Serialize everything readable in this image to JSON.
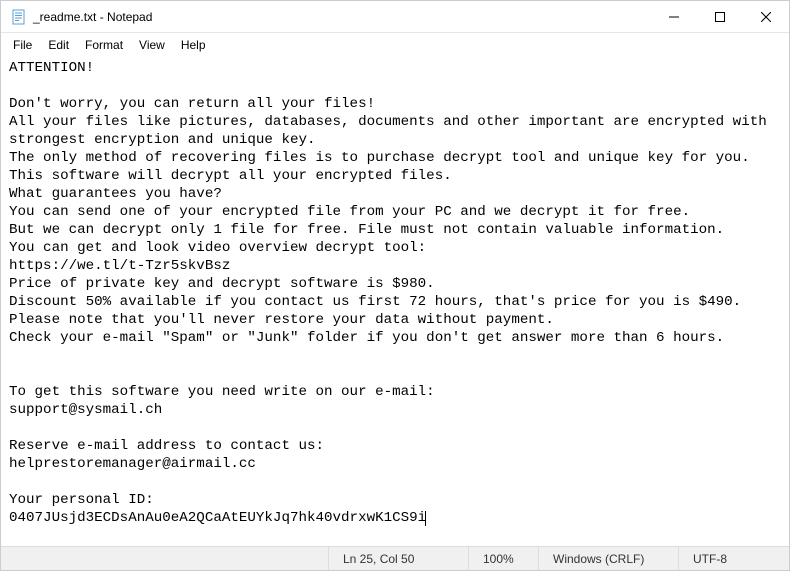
{
  "titlebar": {
    "title": "_readme.txt - Notepad"
  },
  "menu": {
    "file": "File",
    "edit": "Edit",
    "format": "Format",
    "view": "View",
    "help": "Help"
  },
  "document": {
    "text": "ATTENTION!\n\nDon't worry, you can return all your files!\nAll your files like pictures, databases, documents and other important are encrypted with strongest encryption and unique key.\nThe only method of recovering files is to purchase decrypt tool and unique key for you.\nThis software will decrypt all your encrypted files.\nWhat guarantees you have?\nYou can send one of your encrypted file from your PC and we decrypt it for free.\nBut we can decrypt only 1 file for free. File must not contain valuable information.\nYou can get and look video overview decrypt tool:\nhttps://we.tl/t-Tzr5skvBsz\nPrice of private key and decrypt software is $980.\nDiscount 50% available if you contact us first 72 hours, that's price for you is $490.\nPlease note that you'll never restore your data without payment.\nCheck your e-mail \"Spam\" or \"Junk\" folder if you don't get answer more than 6 hours.\n\n\nTo get this software you need write on our e-mail:\nsupport@sysmail.ch\n\nReserve e-mail address to contact us:\nhelprestoremanager@airmail.cc\n\nYour personal ID:\n0407JUsjd3ECDsAnAu0eA2QCaAtEUYkJq7hk40vdrxwK1CS9i"
  },
  "statusbar": {
    "position": "Ln 25, Col 50",
    "zoom": "100%",
    "eol": "Windows (CRLF)",
    "encoding": "UTF-8"
  }
}
